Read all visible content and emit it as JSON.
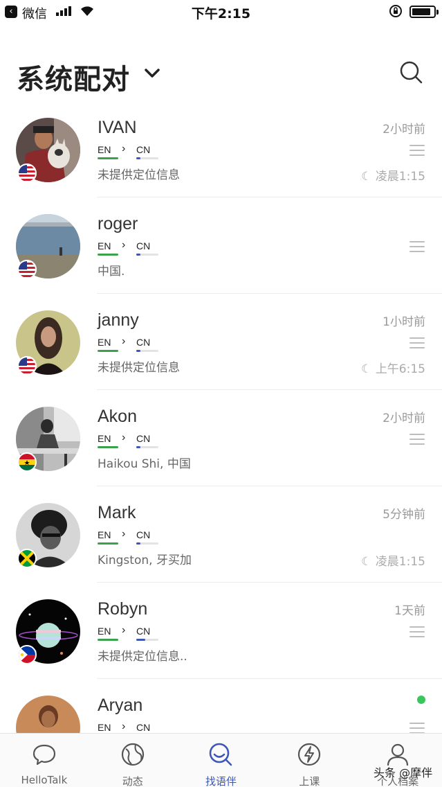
{
  "status_bar": {
    "carrier": "微信",
    "time": "下午2:15"
  },
  "header": {
    "title": "系统配对"
  },
  "users": [
    {
      "name": "IVAN",
      "native": "EN",
      "learning": "CN",
      "learning_level": 0.2,
      "location": "未提供定位信息",
      "ago": "2小时前",
      "local_time": "凌晨1:15",
      "flag": "us-flag",
      "online": false
    },
    {
      "name": "roger",
      "native": "EN",
      "learning": "CN",
      "learning_level": 0.2,
      "location": "中国.",
      "ago": "",
      "local_time": "",
      "flag": "us-flag",
      "online": false
    },
    {
      "name": "janny",
      "native": "EN",
      "learning": "CN",
      "learning_level": 0.2,
      "location": "未提供定位信息",
      "ago": "1小时前",
      "local_time": "上午6:15",
      "flag": "us-flag",
      "online": false
    },
    {
      "name": "Akon",
      "native": "EN",
      "learning": "CN",
      "learning_level": 0.2,
      "location": "Haikou Shi, 中国",
      "ago": "2小时前",
      "local_time": "",
      "flag": "ghana-flag",
      "online": false
    },
    {
      "name": "Mark",
      "native": "EN",
      "learning": "CN",
      "learning_level": 0.2,
      "location": "Kingston, 牙买加",
      "ago": "5分钟前",
      "local_time": "凌晨1:15",
      "flag": "jamaica-flag",
      "online": false
    },
    {
      "name": "Robyn",
      "native": "EN",
      "learning": "CN",
      "learning_level": 0.4,
      "location": "未提供定位信息..",
      "ago": "1天前",
      "local_time": "",
      "flag": "philippines-flag",
      "online": false
    },
    {
      "name": "Aryan",
      "native": "EN",
      "learning": "CN",
      "learning_level": 0.2,
      "location": "",
      "ago": "",
      "local_time": "",
      "flag": "",
      "online": true
    }
  ],
  "tabs": [
    {
      "label": "HelloTalk",
      "icon": "chat-bubble-icon",
      "active": false
    },
    {
      "label": "动态",
      "icon": "globe-icon",
      "active": false
    },
    {
      "label": "找语伴",
      "icon": "search-partner-icon",
      "active": true
    },
    {
      "label": "上课",
      "icon": "lightning-icon",
      "active": false
    },
    {
      "label": "个人档案",
      "icon": "profile-icon",
      "active": false
    }
  ],
  "watermark": "头条 @摩伴",
  "colors": {
    "accent": "#3d56b8",
    "native_bar": "#3aa24b",
    "online": "#38c75b"
  }
}
